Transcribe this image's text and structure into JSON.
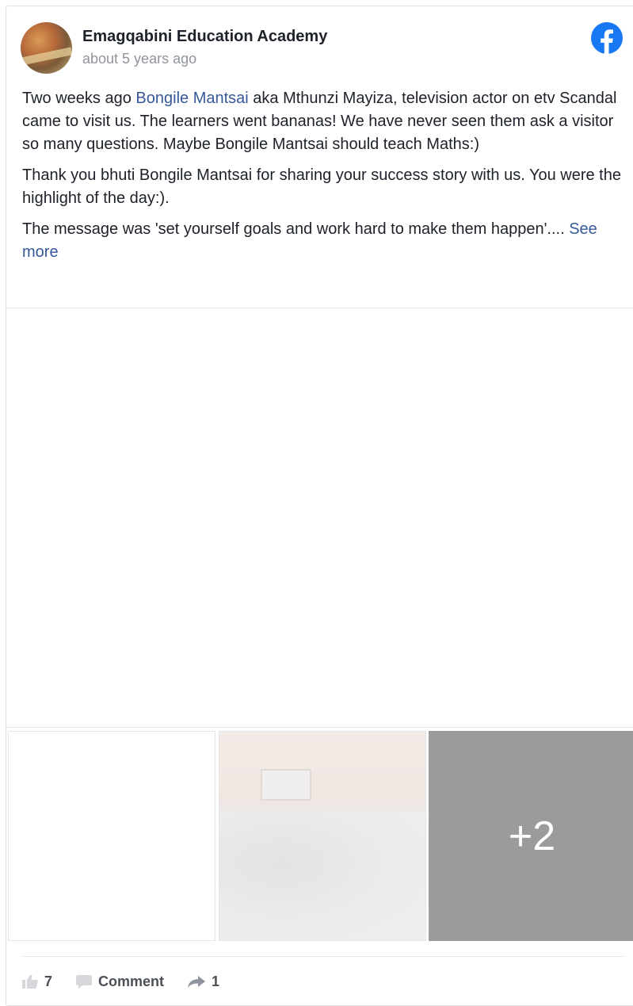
{
  "post": {
    "page_name": "Emagqabini Education Academy",
    "timestamp": "about 5 years ago",
    "paragraph1_before": "Two weeks ago ",
    "paragraph1_link": "Bongile Mantsai",
    "paragraph1_after": " aka Mthunzi Mayiza, television actor on etv Scandal came to visit us. The learners went bananas! We have never seen them ask a visitor so many questions. Maybe Bongile Mantsai should teach Maths:)",
    "paragraph2": "Thank you bhuti Bongile Mantsai for sharing your success story with us. You were the highlight of the day:).",
    "paragraph3": " The message was 'set yourself goals and work hard to make them happen'.... ",
    "see_more": "See more"
  },
  "media": {
    "more_count": "+2"
  },
  "actions": {
    "likes": "7",
    "comment_label": "Comment",
    "shares": "1"
  },
  "colors": {
    "brand": "#1877f2",
    "link": "#365899",
    "overlay": "#9b9b9b"
  }
}
